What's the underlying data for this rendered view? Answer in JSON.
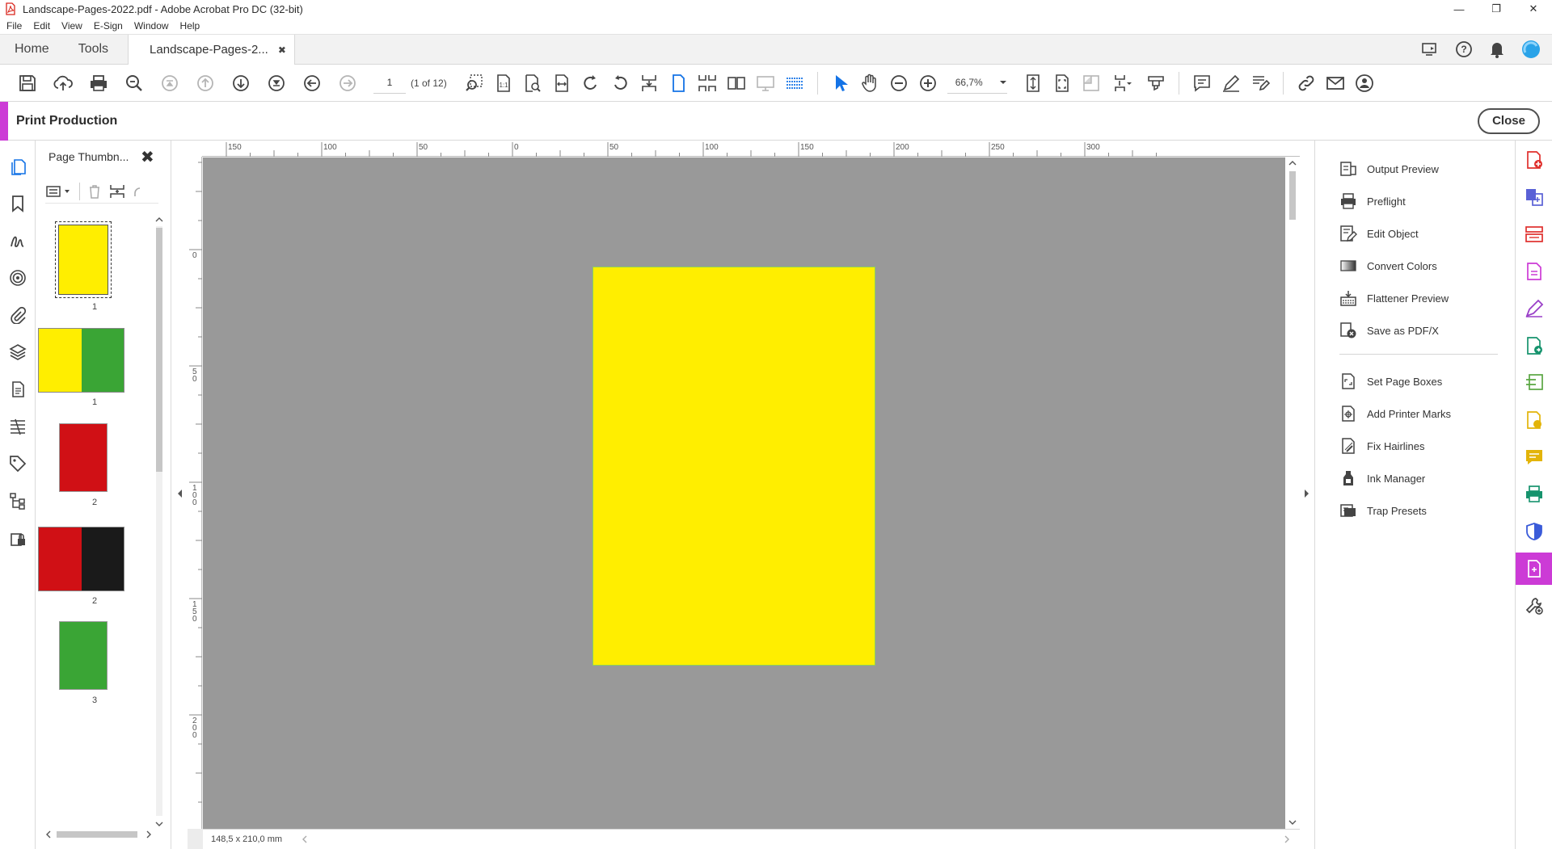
{
  "window": {
    "title": "Landscape-Pages-2022.pdf - Adobe Acrobat Pro DC (32-bit)",
    "minimize": "—",
    "restore": "❐",
    "close": "✕"
  },
  "menu": [
    "File",
    "Edit",
    "View",
    "E-Sign",
    "Window",
    "Help"
  ],
  "tabs": {
    "home": "Home",
    "tools": "Tools",
    "document": "Landscape-Pages-2...",
    "document_close": "✖"
  },
  "toolbar": {
    "page_current": "1",
    "page_count": "(1 of 12)",
    "zoom": "66,7%"
  },
  "print_production": {
    "title": "Print Production",
    "close_label": "Close"
  },
  "thumbnails": {
    "title": "Page Thumbn...",
    "close": "✖",
    "items": [
      {
        "label": "1",
        "colors": [
          "#ffee00"
        ],
        "orientation": "portrait",
        "selected": true
      },
      {
        "label": "1",
        "colors": [
          "#ffee00",
          "#3aa535"
        ],
        "orientation": "landscape"
      },
      {
        "label": "2",
        "colors": [
          "#d01015"
        ],
        "orientation": "portrait"
      },
      {
        "label": "2",
        "colors": [
          "#d01015",
          "#1a1a1a"
        ],
        "orientation": "landscape"
      },
      {
        "label": "3",
        "colors": [
          "#3aa535"
        ],
        "orientation": "portrait"
      }
    ]
  },
  "ruler": {
    "h_labels": [
      "150",
      "100",
      "50",
      "0",
      "50",
      "100",
      "150",
      "200",
      "250",
      "300"
    ],
    "v_labels": [
      "0",
      "50",
      "100",
      "150",
      "200"
    ]
  },
  "document": {
    "page_color": "#ffee00",
    "page_size": "148,5 x 210,0 mm"
  },
  "tools": {
    "group1": [
      {
        "label": "Output Preview",
        "icon": "output-preview-icon"
      },
      {
        "label": "Preflight",
        "icon": "preflight-icon"
      },
      {
        "label": "Edit Object",
        "icon": "edit-object-icon"
      },
      {
        "label": "Convert Colors",
        "icon": "convert-colors-icon"
      },
      {
        "label": "Flattener Preview",
        "icon": "flattener-preview-icon"
      },
      {
        "label": "Save as PDF/X",
        "icon": "save-as-pdfx-icon"
      }
    ],
    "group2": [
      {
        "label": "Set Page Boxes",
        "icon": "set-page-boxes-icon"
      },
      {
        "label": "Add Printer Marks",
        "icon": "add-printer-marks-icon"
      },
      {
        "label": "Fix Hairlines",
        "icon": "fix-hairlines-icon"
      },
      {
        "label": "Ink Manager",
        "icon": "ink-manager-icon"
      },
      {
        "label": "Trap Presets",
        "icon": "trap-presets-icon"
      }
    ]
  },
  "colors": {
    "accent": "#cc3bd6",
    "canvas": "#999999",
    "toolbar_blue": "#1473e6"
  }
}
